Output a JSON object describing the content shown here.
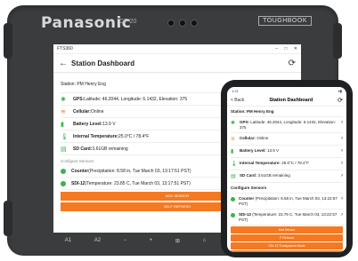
{
  "tablet": {
    "brand": "Panasonic",
    "model": "CF-20",
    "badge": "TOUGHBOOK",
    "window": {
      "app": "FTS360",
      "minimize": "–",
      "maximize": "□",
      "close": "✕"
    },
    "header": {
      "back": "←",
      "title": "Station Dashboard",
      "sync": "⟳"
    },
    "station_line": "Station: PM Henry Eng",
    "rows": [
      {
        "icon": "✺",
        "label": "GPS:",
        "value": " Latitude: 46.2044, Longitude: 6.1432, Elevation: 375",
        "color": "#3bb34a"
      },
      {
        "icon": "≋",
        "label": "Cellular:",
        "value": " Online",
        "color": "#f47920"
      },
      {
        "icon": "▮",
        "label": "Battery Level:",
        "value": " 13.9 V",
        "color": "#3bb34a"
      },
      {
        "icon": "🌡",
        "label": "Internal Temperature:",
        "value": " 25.0°C / 78.4°F",
        "color": "#3bb34a"
      },
      {
        "icon": "▤",
        "label": "SD Card:",
        "value": " 3.61GB remaining",
        "color": "#3bb34a"
      }
    ],
    "configure_label": "Configure Sensors",
    "sensors": [
      {
        "name": "Counter",
        "detail": " (Precipitation: 8.58 in, Tue March 03, 13:17:51 PST)"
      },
      {
        "name": "SDI-12",
        "detail": " (Temperature: 23.85 C, Tue March 03, 13:17:51 PST)"
      }
    ],
    "buttons": [
      "ADD SENSOR",
      "SELF REFRESH"
    ],
    "taskbar": [
      "A1",
      "A2",
      "−",
      "+",
      "⊞",
      "⌂",
      "−▢ +▢",
      "⏻"
    ]
  },
  "phone": {
    "status_time": "1:21",
    "status_icons": "▾▮",
    "back": "< Back",
    "title": "Station Dashboard",
    "sync": "⟳",
    "station_line": "Station: PM Henry Eng",
    "rows": [
      {
        "icon": "✺",
        "label": "GPS:",
        "value": " Latitude: 46.2044, Longitude: 6.1432, Elevation: 375",
        "color": "#3bb34a"
      },
      {
        "icon": "≋",
        "label": "Cellular:",
        "value": " Online",
        "color": "#f47920"
      },
      {
        "icon": "▮",
        "label": "Battery Level:",
        "value": " 13.9 V",
        "color": "#3bb34a"
      },
      {
        "icon": "🌡",
        "label": "Internal Temperature:",
        "value": " 25.0°C / 78.4°F",
        "color": "#3bb34a"
      },
      {
        "icon": "▤",
        "label": "SD Card:",
        "value": " 3.61GB remaining",
        "color": "#3bb34a"
      }
    ],
    "configure_label": "Configure Sensors",
    "sensors": [
      {
        "name": "Counter",
        "detail": " (Precipitation: 8.58 in, Tue March 03, 13:22:57 PST)"
      },
      {
        "name": "SDI-12",
        "detail": " (Temperature: 23.79 C, Tue March 03, 13:22:57 PST)"
      }
    ],
    "buttons": [
      "Add Sensor",
      "F Refresh",
      "SDI-12 Transparent Mode",
      "Load 10 hours of Data"
    ]
  },
  "colors": {
    "accent": "#f47920",
    "ok": "#3bb34a"
  }
}
